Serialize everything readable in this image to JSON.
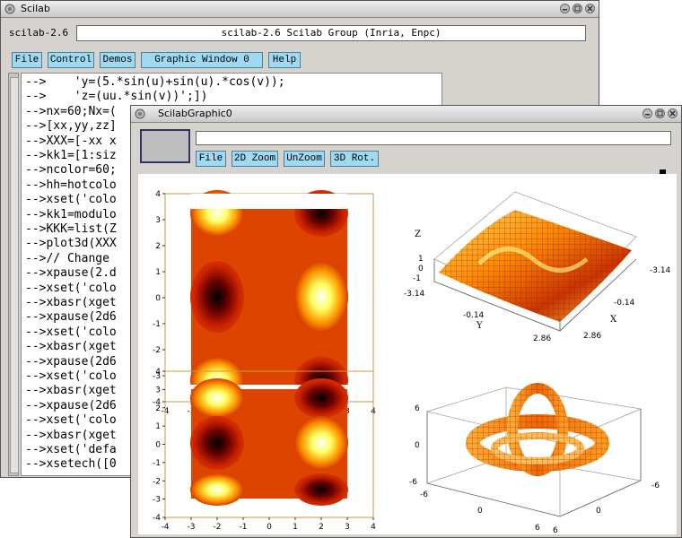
{
  "main_window": {
    "title": "Scilab",
    "version_tab": "scilab-2.6",
    "header_text": "scilab-2.6 Scilab Group (Inria, Enpc)",
    "menu": [
      "File",
      "Control",
      "Demos",
      "Graphic Window  0",
      "Help"
    ],
    "console_lines": [
      "-->    'y=(5.*sin(u)+sin(u).*cos(v));",
      "-->    'z=(uu.*sin(v))';])",
      "-->nx=60;Nx=(",
      "-->[xx,yy,zz]",
      "-->XXX=[-xx x",
      "-->kk1=[1:siz",
      "-->ncolor=60;",
      "-->hh=hotcolo",
      "-->xset('colo",
      "-->kk1=modulo",
      "-->KKK=list(Z",
      "-->plot3d(XXX",
      "-->// Change",
      "-->xpause(2.d",
      "-->xset('colo",
      "-->xbasr(xget",
      "-->xpause(2d6",
      "-->xset('colo",
      "-->xbasr(xget",
      "-->xpause(2d6",
      "-->xset('colo",
      "-->xbasr(xget",
      "-->xpause(2d6",
      "-->xset('colo",
      "-->xbasr(xget",
      "-->xset('defa",
      "-->xsetech([0"
    ]
  },
  "graphic_window": {
    "title": "ScilabGraphic0",
    "menu": [
      "File",
      "2D Zoom",
      "UnZoom",
      "3D Rot."
    ],
    "plot2d_ticks_x": [
      "-4",
      "-3",
      "-2",
      "-1",
      "0",
      "1",
      "2",
      "3",
      "4"
    ],
    "plot2d_ticks_y": [
      "4",
      "3",
      "2",
      "1",
      "0",
      "-1",
      "-2",
      "-3",
      "-4"
    ],
    "surf_labels": {
      "z": "Z",
      "x": "X",
      "y": "Y",
      "z_ticks": [
        "1",
        "0",
        "-1"
      ],
      "y_ticks": [
        "-3.14",
        "-0.14",
        "2.86"
      ],
      "x_ticks": [
        "-3.14",
        "-0.14",
        "2.86"
      ]
    },
    "torus_labels": {
      "z_ticks": [
        "6",
        "0",
        "-6"
      ],
      "x_ticks": [
        "-6",
        "0",
        "6"
      ],
      "y_ticks": [
        "-6",
        "0",
        "6"
      ]
    }
  }
}
